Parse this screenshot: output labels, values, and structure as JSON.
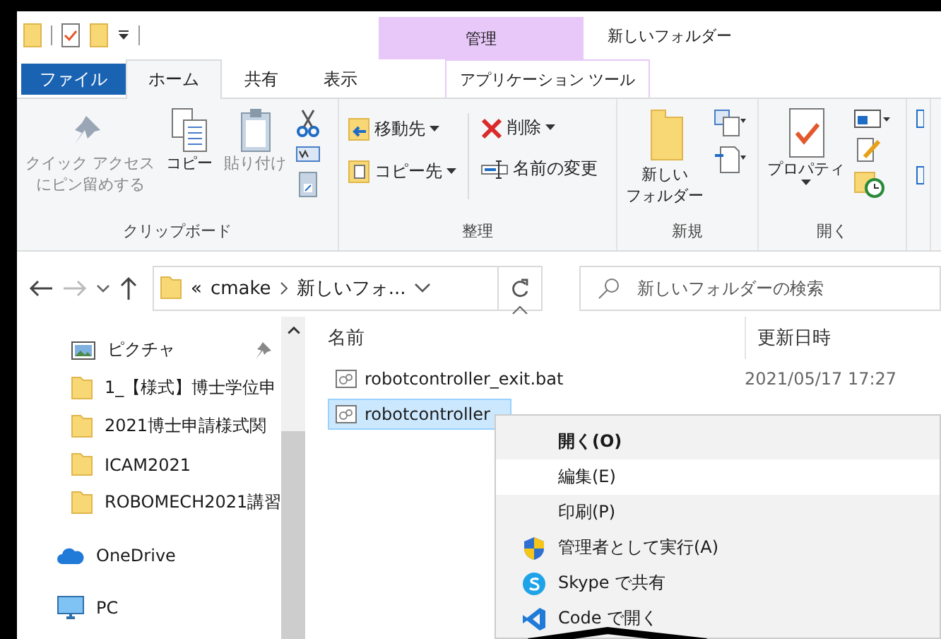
{
  "window": {
    "title": "新しいフォルダー"
  },
  "contextual_group": "管理",
  "tabs": [
    {
      "label": "ファイル",
      "kind": "file",
      "selected": false
    },
    {
      "label": "ホーム",
      "kind": "normal",
      "selected": true
    },
    {
      "label": "共有",
      "kind": "normal",
      "selected": false
    },
    {
      "label": "表示",
      "kind": "normal",
      "selected": false
    },
    {
      "label": "アプリケーション ツール",
      "kind": "contextual",
      "selected": false
    }
  ],
  "ribbon": {
    "groups": [
      {
        "label": "クリップボード",
        "commands": [
          {
            "kind": "large",
            "lines": [
              "クイック アクセス",
              "にピン留めする"
            ],
            "disabled": true
          },
          {
            "kind": "large",
            "label": "コピー",
            "disabled": false
          },
          {
            "kind": "large",
            "label": "貼り付け",
            "disabled": true
          }
        ]
      },
      {
        "label": "整理",
        "commands": [
          {
            "kind": "small",
            "label": "移動先",
            "dropdown": true
          },
          {
            "kind": "small",
            "label": "コピー先",
            "dropdown": true
          },
          {
            "kind": "small",
            "label": "削除",
            "dropdown": true
          },
          {
            "kind": "small",
            "label": "名前の変更",
            "dropdown": false
          }
        ]
      },
      {
        "label": "新規",
        "commands": [
          {
            "kind": "large",
            "lines": [
              "新しい",
              "フォルダー"
            ],
            "disabled": false
          }
        ]
      },
      {
        "label": "開く",
        "commands": [
          {
            "kind": "large",
            "label": "プロパティ",
            "disabled": false,
            "dropdown": true
          }
        ]
      }
    ]
  },
  "address": {
    "segments": [
      "«",
      "cmake",
      "新しいフォ..."
    ]
  },
  "search": {
    "placeholder": "新しいフォルダーの検索"
  },
  "navigation": [
    {
      "label": "ピクチャ",
      "kind": "pictures",
      "pinned": true
    },
    {
      "label": "1_【様式】博士学位申",
      "kind": "folder",
      "pinned": false
    },
    {
      "label": "2021博士申請様式関",
      "kind": "folder",
      "pinned": false
    },
    {
      "label": "ICAM2021",
      "kind": "folder",
      "pinned": false
    },
    {
      "label": "ROBOMECH2021講習",
      "kind": "folder",
      "pinned": false
    },
    {
      "label": "OneDrive",
      "kind": "cloud",
      "pinned": false
    },
    {
      "label": "PC",
      "kind": "computer",
      "pinned": false
    }
  ],
  "columns": [
    "名前",
    "更新日時"
  ],
  "files": [
    {
      "name": "robotcontroller_exit.bat",
      "modified": "2021/05/17 17:27",
      "selected": false
    },
    {
      "name": "robotcontroller",
      "selected": true
    }
  ],
  "context_menu": [
    {
      "label": "開く(O)",
      "kind": "default",
      "highlighted": false
    },
    {
      "label": "編集(E)",
      "kind": "plain",
      "highlighted": true
    },
    {
      "label": "印刷(P)",
      "kind": "plain",
      "highlighted": false
    },
    {
      "label": "管理者として実行(A)",
      "kind": "admin",
      "highlighted": false
    },
    {
      "label": "Skype で共有",
      "kind": "share",
      "highlighted": false
    },
    {
      "label": "Code で開く",
      "kind": "editor",
      "highlighted": false
    }
  ]
}
